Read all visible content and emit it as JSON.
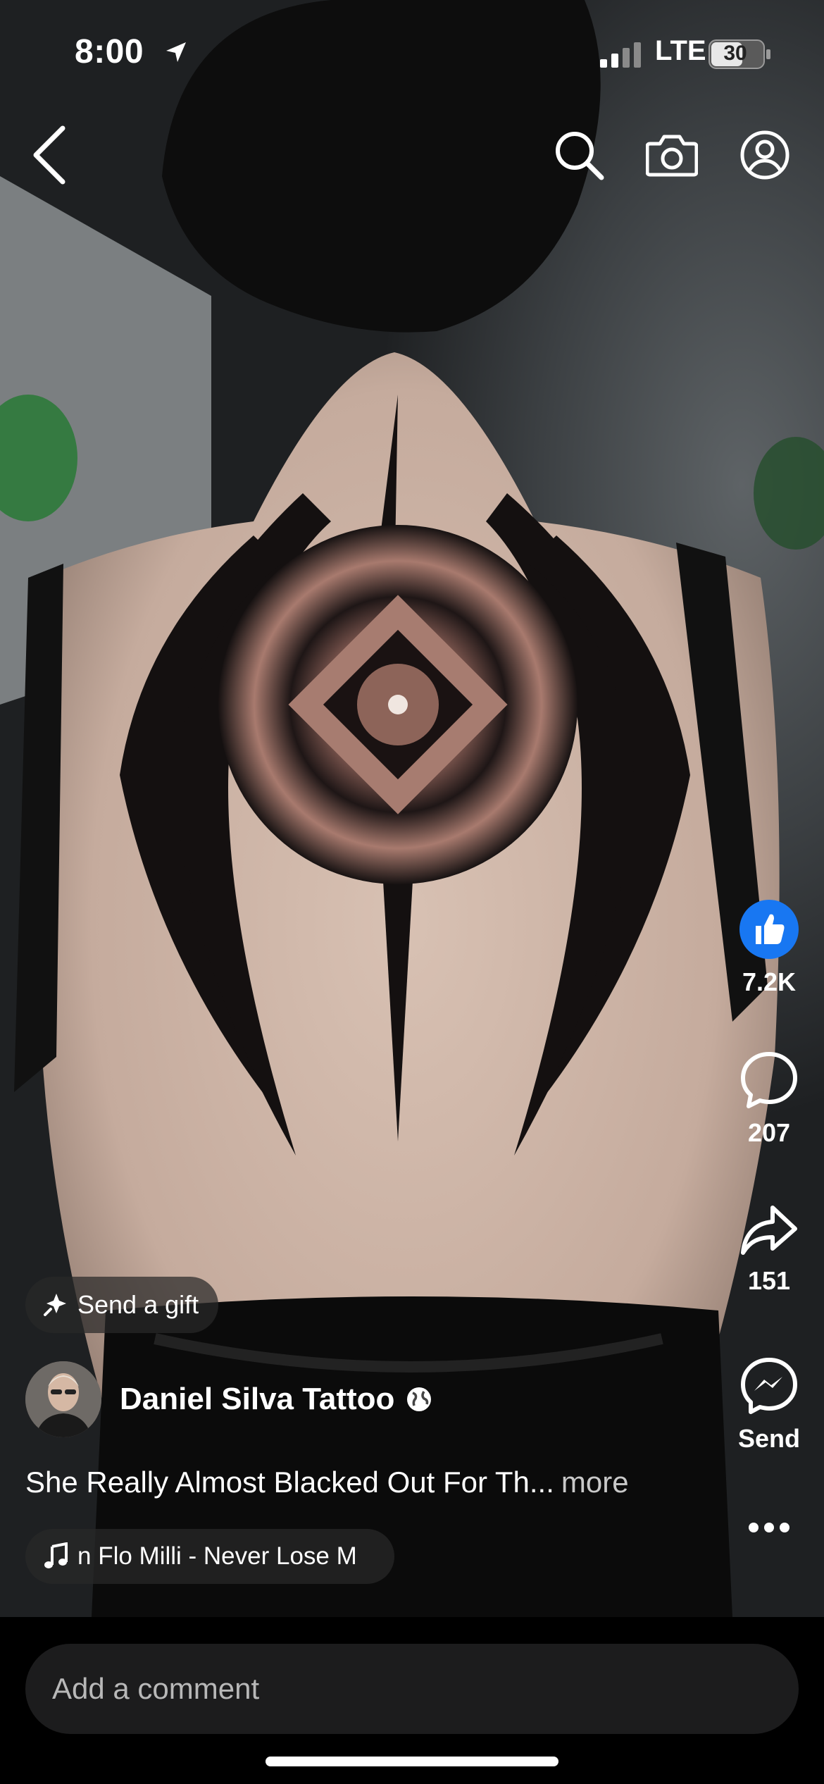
{
  "status_bar": {
    "time": "8:00",
    "network": "LTE",
    "battery": "30"
  },
  "top_nav": {
    "back_icon": "chevron-left-icon",
    "search_icon": "search-icon",
    "camera_icon": "camera-icon",
    "profile_icon": "profile-icon"
  },
  "actions": {
    "like_count": "7.2K",
    "comment_count": "207",
    "share_count": "151",
    "send_label": "Send"
  },
  "post": {
    "gift_label": "Send a gift",
    "author": "Daniel Silva Tattoo",
    "caption": "She Really Almost Blacked Out For Th...",
    "more_label": "more",
    "music": "n Flo Milli - Never Lose M"
  },
  "comment": {
    "placeholder": "Add a comment"
  },
  "colors": {
    "like_blue": "#1877F2",
    "bar_bg": "#000000",
    "input_bg": "#1C1C1D"
  }
}
